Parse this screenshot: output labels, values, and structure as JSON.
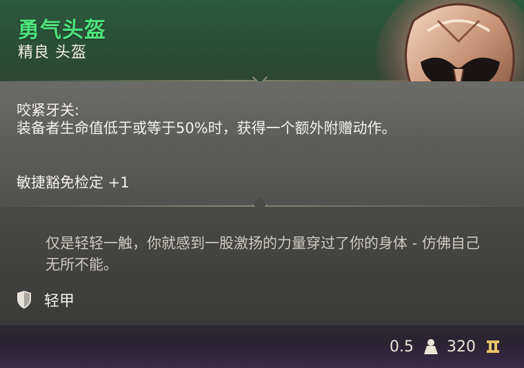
{
  "item": {
    "name": "勇气头盔",
    "subtitle": "精良 头盔",
    "rarity_color": "#4ee27d"
  },
  "effect": {
    "title": "咬紧牙关:",
    "description": "装备者生命值低于或等于50%时，获得一个额外附赠动作。",
    "stat": "敏捷豁免检定 +1"
  },
  "flavor": {
    "text": "仅是轻轻一触，你就感到一股激扬的力量穿过了你的身体 - 仿佛自己无所不能。"
  },
  "armor": {
    "icon": "shield-icon",
    "label": "轻甲"
  },
  "footer": {
    "weight": "0.5",
    "weight_icon": "weight-icon",
    "price": "320",
    "price_icon": "gold-coin-icon"
  },
  "art": {
    "icon": "helmet-icon"
  }
}
